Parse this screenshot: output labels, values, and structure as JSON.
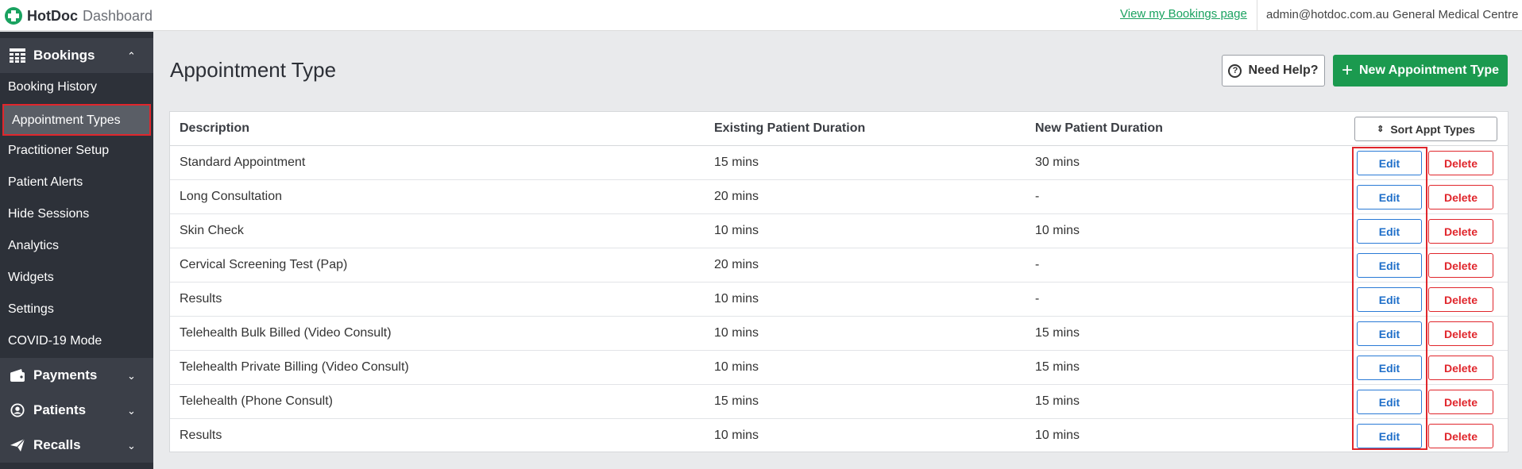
{
  "header": {
    "brand": "HotDoc",
    "subtitle": "Dashboard",
    "view_bookings_link": "View my Bookings page",
    "user_email": "admin@hotdoc.com.au",
    "clinic_name": "General Medical Centre"
  },
  "sidebar": {
    "bookings_label": "Bookings",
    "bookings_items": [
      {
        "label": "Booking History"
      },
      {
        "label": "Appointment Types"
      },
      {
        "label": "Practitioner Setup"
      },
      {
        "label": "Patient Alerts"
      },
      {
        "label": "Hide Sessions"
      },
      {
        "label": "Analytics"
      },
      {
        "label": "Widgets"
      },
      {
        "label": "Settings"
      },
      {
        "label": "COVID-19 Mode"
      }
    ],
    "active_item": "Appointment Types",
    "payments_label": "Payments",
    "patients_label": "Patients",
    "recalls_label": "Recalls"
  },
  "main": {
    "page_title": "Appointment Type",
    "help_label": "Need Help?",
    "new_label": "New Appointment Type",
    "sort_label": "Sort Appt Types",
    "columns": {
      "description": "Description",
      "existing": "Existing Patient Duration",
      "new": "New Patient Duration"
    },
    "edit_label": "Edit",
    "delete_label": "Delete",
    "rows": [
      {
        "description": "Standard Appointment",
        "existing": "15 mins",
        "new": "30 mins"
      },
      {
        "description": "Long Consultation",
        "existing": "20 mins",
        "new": "-"
      },
      {
        "description": "Skin Check",
        "existing": "10 mins",
        "new": "10 mins"
      },
      {
        "description": "Cervical Screening Test (Pap)",
        "existing": "20 mins",
        "new": "-"
      },
      {
        "description": "Results",
        "existing": "10 mins",
        "new": "-"
      },
      {
        "description": "Telehealth Bulk Billed (Video Consult)",
        "existing": "10 mins",
        "new": "15 mins"
      },
      {
        "description": "Telehealth Private Billing (Video Consult)",
        "existing": "10 mins",
        "new": "15 mins"
      },
      {
        "description": "Telehealth (Phone Consult)",
        "existing": "15 mins",
        "new": "15 mins"
      },
      {
        "description": "Results",
        "existing": "10 mins",
        "new": "10 mins"
      }
    ]
  },
  "colors": {
    "brand_green": "#1aa260",
    "sidebar_bg": "#2d3139",
    "edit_blue": "#1f6fc9",
    "delete_red": "#e0262c"
  }
}
